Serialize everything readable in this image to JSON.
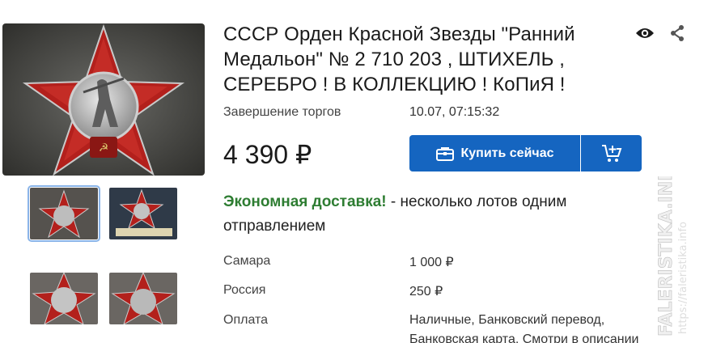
{
  "listing": {
    "title": "СССР Орден Красной Звезды \"Ранний Медальон\" № 2 710 203 , ШТИХЕЛЬ , СЕРЕБРО ! В КОЛЛЕКЦИЮ ! КоПиЯ !",
    "end_label": "Завершение торгов",
    "end_value": "10.07, 07:15:32",
    "price": "4 390 ₽",
    "buy_label": "Купить сейчас"
  },
  "delivery": {
    "highlight": "Экономная доставка!",
    "text": " - несколько лотов одним отправлением"
  },
  "shipping": [
    {
      "label": "Самара",
      "value": "1 000 ₽"
    },
    {
      "label": "Россия",
      "value": "250 ₽"
    },
    {
      "label": "Оплата",
      "value": "Наличные, Банковский перевод,"
    },
    {
      "label": "",
      "value": "Банковская карта, Смотри в описании"
    }
  ],
  "watermark": {
    "brand": "FALERISTIKA.INFO",
    "url": "https://faleristika.info"
  },
  "icons": [
    "eye-icon",
    "share-icon",
    "briefcase-icon",
    "cart-add-icon"
  ],
  "colors": {
    "accent": "#1565c0",
    "green": "#2e7d32"
  }
}
